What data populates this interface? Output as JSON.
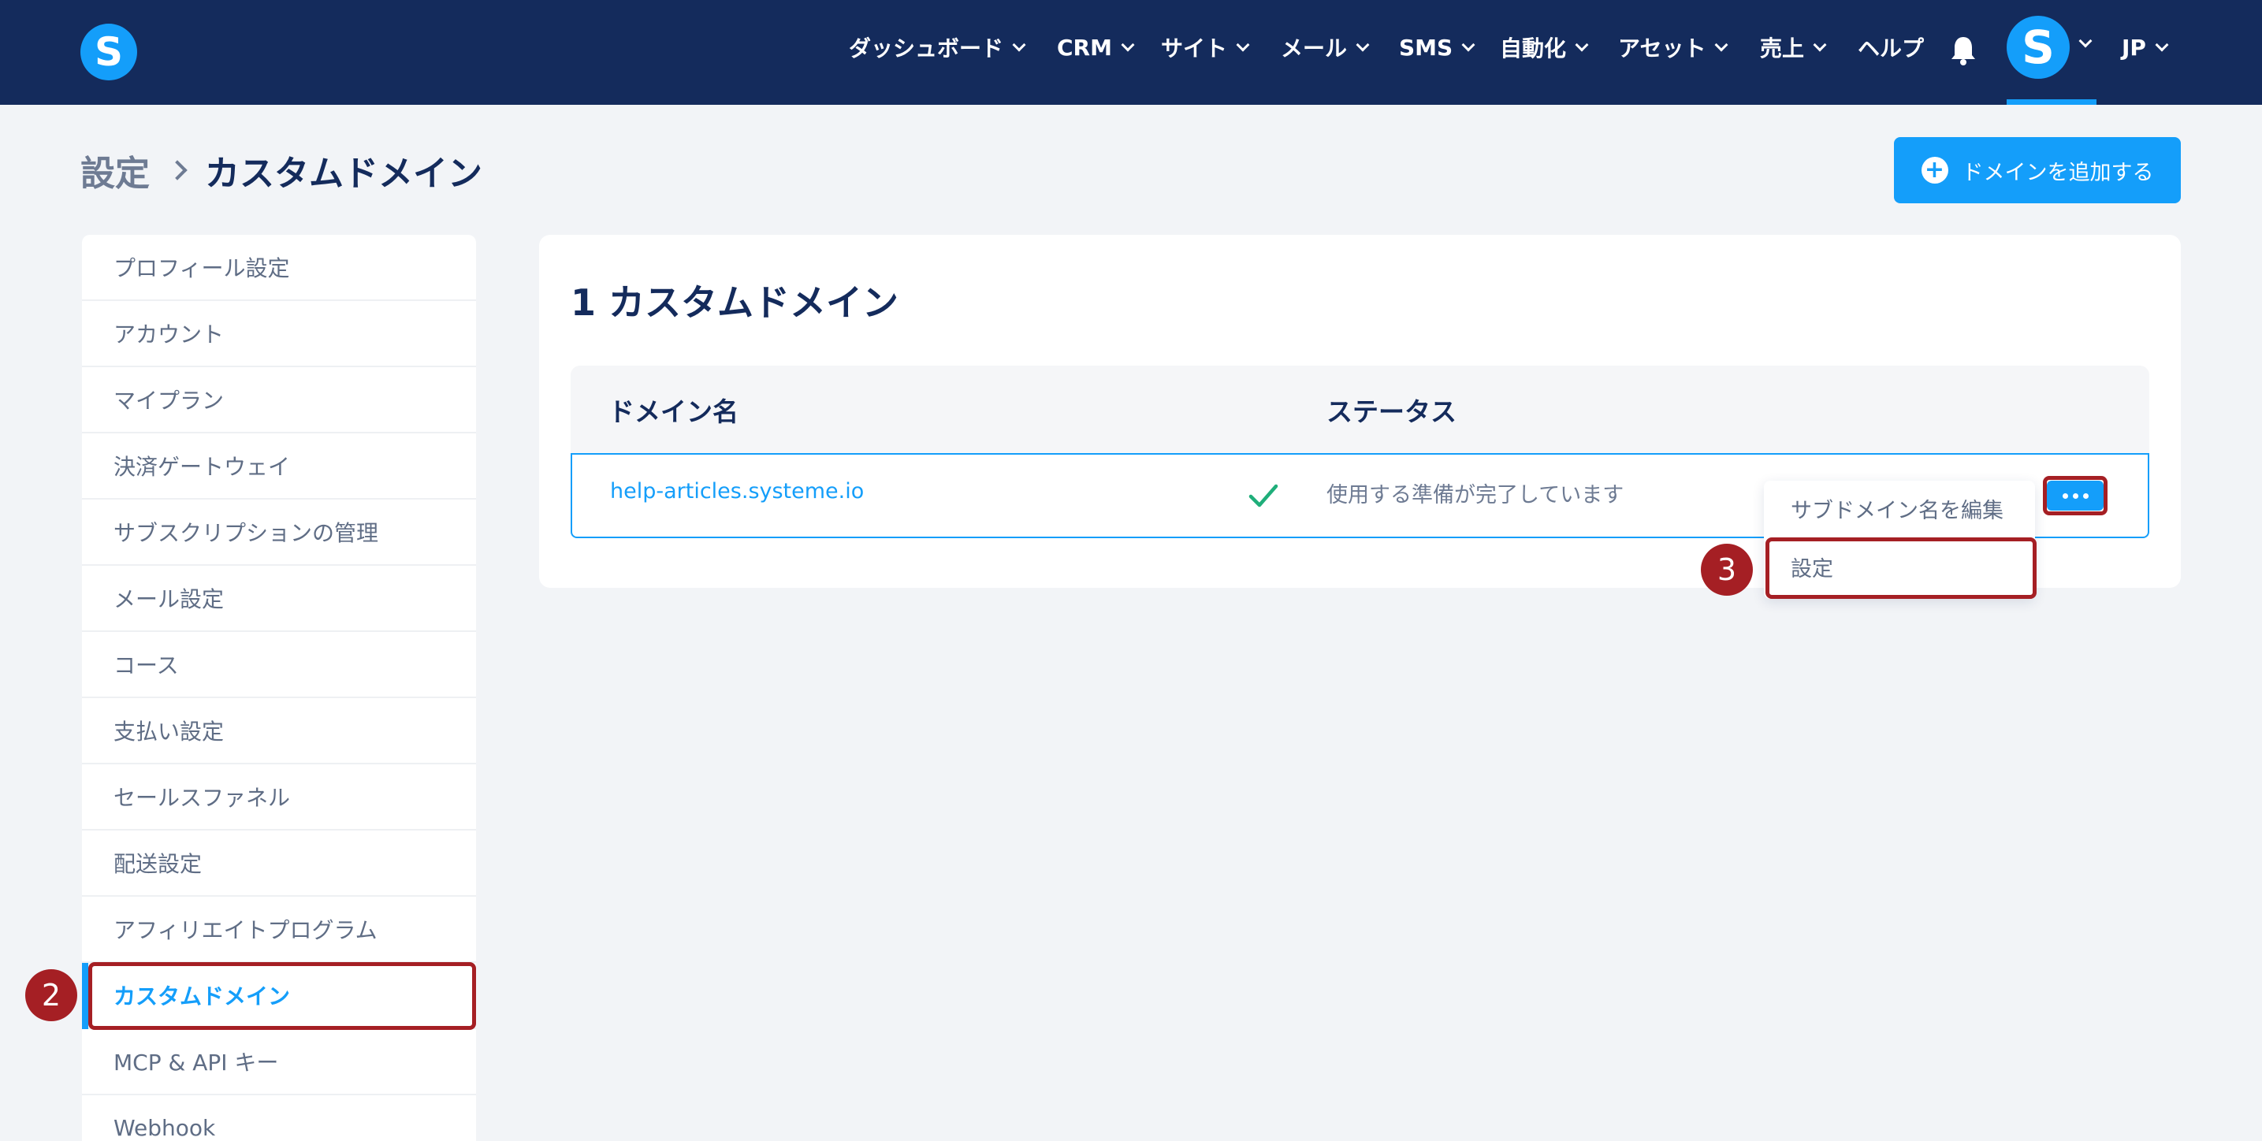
{
  "topnav": {
    "logo_letter": "S",
    "items": [
      {
        "label": "ダッシュボード",
        "has_dropdown": true
      },
      {
        "label": "CRM",
        "has_dropdown": true
      },
      {
        "label": "サイト",
        "has_dropdown": true
      },
      {
        "label": "メール",
        "has_dropdown": true
      },
      {
        "label": "SMS",
        "has_dropdown": true
      },
      {
        "label": "自動化",
        "has_dropdown": true
      },
      {
        "label": "アセット",
        "has_dropdown": true
      },
      {
        "label": "売上",
        "has_dropdown": true
      },
      {
        "label": "ヘルプ",
        "has_dropdown": false
      }
    ],
    "avatar_letter": "S",
    "language": "JP"
  },
  "header": {
    "breadcrumb_parent": "設定",
    "breadcrumb_current": "カスタムドメイン",
    "add_domain_label": "ドメインを追加する"
  },
  "sidebar": {
    "items": [
      {
        "label": "プロフィール設定"
      },
      {
        "label": "アカウント"
      },
      {
        "label": "マイプラン"
      },
      {
        "label": "決済ゲートウェイ"
      },
      {
        "label": "サブスクリプションの管理"
      },
      {
        "label": "メール設定"
      },
      {
        "label": "コース"
      },
      {
        "label": "支払い設定"
      },
      {
        "label": "セールスファネル"
      },
      {
        "label": "配送設定"
      },
      {
        "label": "アフィリエイトプログラム"
      },
      {
        "label": "カスタムドメイン",
        "active": true
      },
      {
        "label": "MCP & API キー"
      },
      {
        "label": "Webhook"
      }
    ]
  },
  "main": {
    "title": "1 カスタムドメイン",
    "table": {
      "columns": [
        "ドメイン名",
        "ステータス"
      ],
      "rows": [
        {
          "domain": "help-articles.systeme.io",
          "status": "使用する準備が完了しています",
          "status_icon": "check-icon"
        }
      ]
    },
    "dropdown": {
      "items": [
        "サブドメイン名を編集",
        "設定"
      ]
    }
  },
  "annotations": {
    "step_2": "2",
    "step_3": "3"
  },
  "colors": {
    "nav_bg": "#142b5c",
    "accent": "#149efa",
    "highlight": "#a51f24",
    "success": "#1fae7a"
  }
}
